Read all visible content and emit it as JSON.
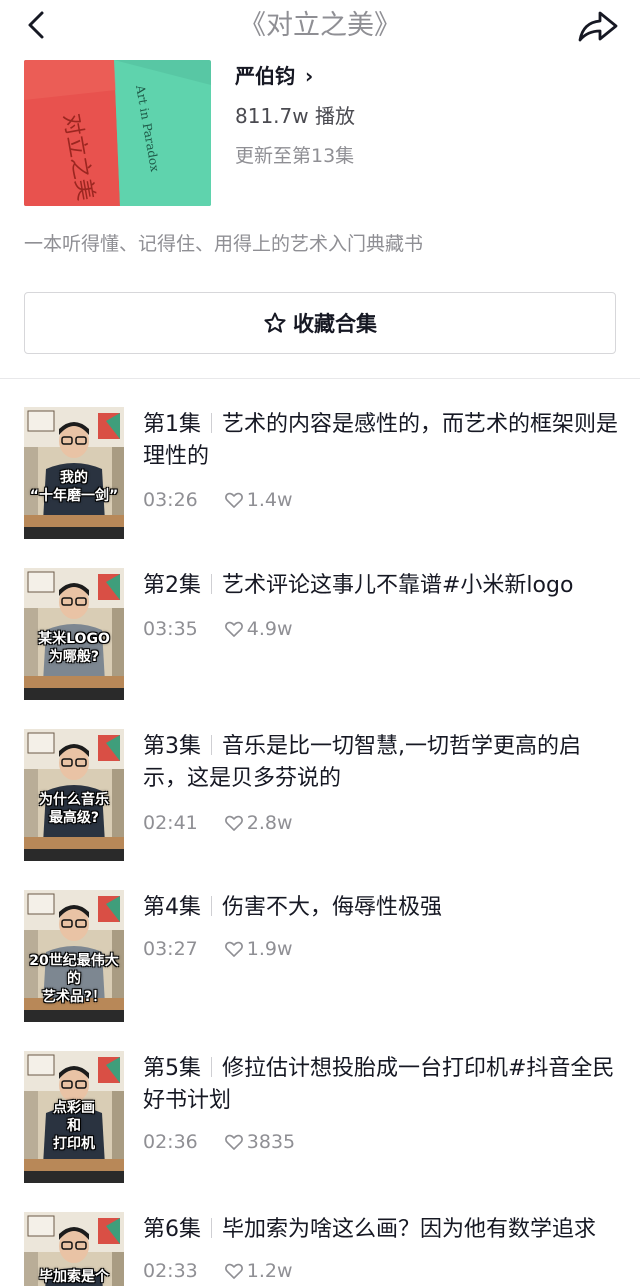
{
  "header": {
    "title": "《对立之美》"
  },
  "collection": {
    "cover_text": "Art in Paradox",
    "author": "严伯钧",
    "plays": "811.7w 播放",
    "update": "更新至第13集",
    "description": "一本听得懂、记得住、用得上的艺术入门典藏书",
    "collect_label": "收藏合集"
  },
  "episodes": [
    {
      "num": "第1集",
      "title": "艺术的内容是感性的，而艺术的框架则是理性的",
      "duration": "03:26",
      "likes": "1.4w",
      "thumb_caption": "我的\n“十年磨一剑”"
    },
    {
      "num": "第2集",
      "title": "艺术评论这事儿不靠谱#小米新logo",
      "duration": "03:35",
      "likes": "4.9w",
      "thumb_caption": "某米LOGO\n为哪般?"
    },
    {
      "num": "第3集",
      "title": "音乐是比一切智慧,一切哲学更高的启示，这是贝多芬说的",
      "duration": "02:41",
      "likes": "2.8w",
      "thumb_caption": "为什么音乐\n最高级?"
    },
    {
      "num": "第4集",
      "title": "伤害不大，侮辱性极强",
      "duration": "03:27",
      "likes": "1.9w",
      "thumb_caption": "20世纪最伟大的\n艺术品?！"
    },
    {
      "num": "第5集",
      "title": "修拉估计想投胎成一台打印机#抖音全民好书计划",
      "duration": "02:36",
      "likes": "3835",
      "thumb_caption": "点彩画\n和\n打印机"
    },
    {
      "num": "第6集",
      "title": "毕加索为啥这么画？因为他有数学追求",
      "duration": "02:33",
      "likes": "1.2w",
      "thumb_caption": "毕加索是个"
    }
  ]
}
